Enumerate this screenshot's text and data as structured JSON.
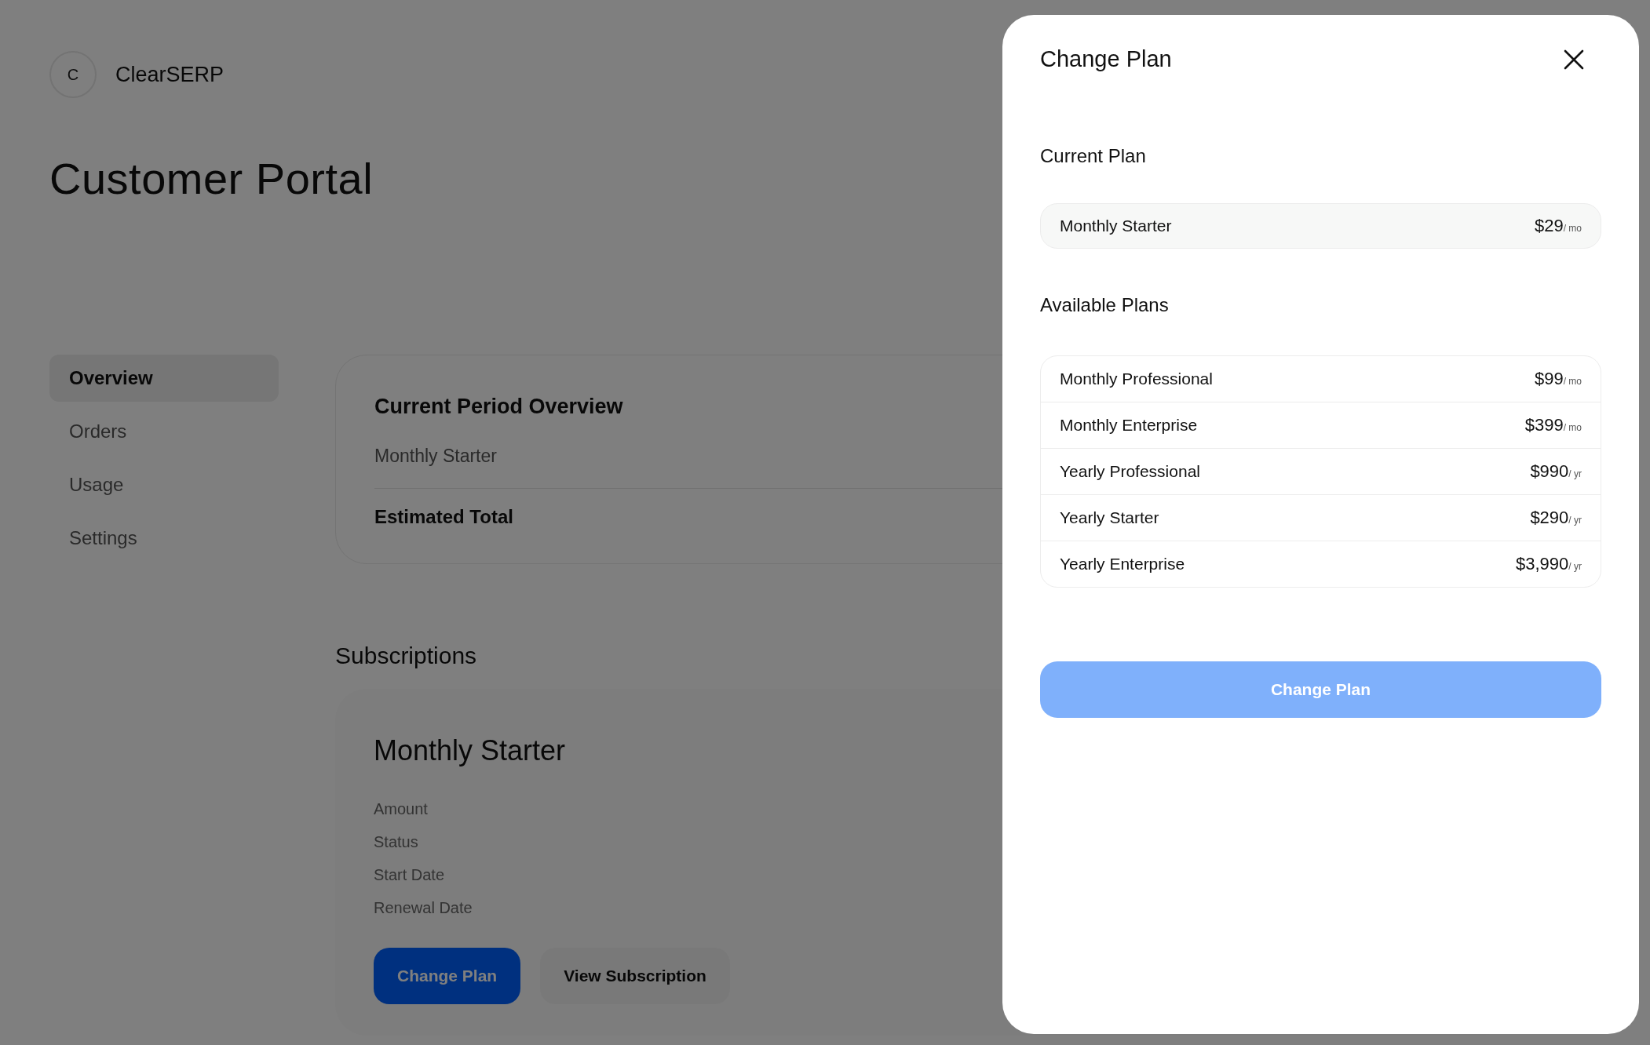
{
  "brand": {
    "initial": "C",
    "name": "ClearSERP"
  },
  "page_title": "Customer Portal",
  "sidebar": {
    "items": [
      {
        "label": "Overview",
        "selected": true
      },
      {
        "label": "Orders",
        "selected": false
      },
      {
        "label": "Usage",
        "selected": false
      },
      {
        "label": "Settings",
        "selected": false
      }
    ]
  },
  "overview_card": {
    "title": "Current Period Overview",
    "plan": "Monthly Starter",
    "total_label": "Estimated Total"
  },
  "subscriptions": {
    "heading": "Subscriptions",
    "card": {
      "title": "Monthly Starter",
      "fields": [
        "Amount",
        "Status",
        "Start Date",
        "Renewal Date"
      ],
      "buttons": [
        {
          "label": "Change Plan",
          "kind": "primary"
        },
        {
          "label": "View Subscription",
          "kind": "secondary"
        }
      ]
    }
  },
  "dialog": {
    "title": "Change Plan",
    "current_heading": "Current Plan",
    "current_plan": {
      "name": "Monthly Starter",
      "price": "$29",
      "period": "/ mo"
    },
    "available_heading": "Available Plans",
    "plans": [
      {
        "name": "Monthly Professional",
        "price": "$99",
        "period": "/ mo"
      },
      {
        "name": "Monthly Enterprise",
        "price": "$399",
        "period": "/ mo"
      },
      {
        "name": "Yearly Professional",
        "price": "$990",
        "period": "/ yr"
      },
      {
        "name": "Yearly Starter",
        "price": "$290",
        "period": "/ yr"
      },
      {
        "name": "Yearly Enterprise",
        "price": "$3,990",
        "period": "/ yr"
      }
    ],
    "submit": {
      "label": "Change Plan",
      "disabled": true
    }
  }
}
